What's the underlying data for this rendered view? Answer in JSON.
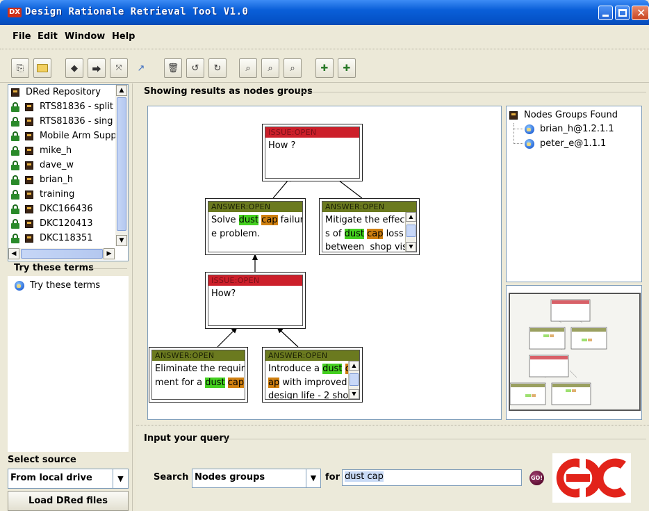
{
  "window": {
    "title": "Design Rationale Retrieval Tool V1.0",
    "icon_text": "DX"
  },
  "menu": [
    "File",
    "Edit",
    "Window",
    "Help"
  ],
  "toolbar": {
    "icons": [
      "copy-icon",
      "open-folder-icon",
      "add-node-icon",
      "add-link-icon",
      "expand-icon",
      "arrow-icon",
      "delete-icon",
      "undo-icon",
      "redo-icon",
      "zoom-icon",
      "zoom-in-icon",
      "zoom-out-icon",
      "add-issue-icon",
      "add-answer-icon"
    ]
  },
  "repository": {
    "root": "DRed Repository",
    "items": [
      "RTS81836 - split",
      "RTS81836 - sing",
      "Mobile Arm Supp",
      "mike_h",
      "dave_w",
      "brian_h",
      "training",
      "DKC166436",
      "DKC120413",
      "DKC118351"
    ]
  },
  "try_terms": {
    "title": "Try these terms",
    "items": [
      "Try these terms"
    ]
  },
  "source": {
    "label": "Select source",
    "value": "From local drive",
    "load_button": "Load DRed files"
  },
  "results": {
    "title": "Showing results as nodes groups",
    "nodes": [
      {
        "type": "ISSUE:OPEN",
        "lines": [
          [
            "How ?"
          ]
        ]
      },
      {
        "type": "ANSWER:OPEN",
        "lines": [
          [
            "Solve ",
            [
              "dust",
              "g"
            ],
            " ",
            [
              "cap",
              "o"
            ],
            " failur"
          ],
          [
            "e problem."
          ]
        ]
      },
      {
        "type": "ANSWER:OPEN",
        "lines": [
          [
            "Mitigate the effect"
          ],
          [
            "s of ",
            [
              "dust",
              "g"
            ],
            " ",
            [
              "cap",
              "o"
            ],
            " loss"
          ],
          [
            "between  shop vis"
          ]
        ]
      },
      {
        "type": "ISSUE:OPEN",
        "lines": [
          [
            "How?"
          ]
        ]
      },
      {
        "type": "ANSWER:OPEN",
        "lines": [
          [
            "Eliminate the require"
          ],
          [
            "ment for a ",
            [
              "dust",
              "g"
            ],
            " ",
            [
              "cap",
              "o"
            ]
          ]
        ]
      },
      {
        "type": "ANSWER:OPEN",
        "lines": [
          [
            "Introduce a ",
            [
              "dust",
              "g"
            ],
            " ",
            [
              "c",
              "o"
            ]
          ],
          [
            [
              "ap",
              "o"
            ],
            " with improved"
          ],
          [
            "design life - 2 sho"
          ]
        ]
      }
    ]
  },
  "groups": {
    "root": "Nodes Groups Found",
    "items": [
      "brian_h@1.2.1.1",
      "peter_e@1.1.1"
    ]
  },
  "query": {
    "title": "Input your query",
    "search_label": "Search",
    "type_value": "Nodes groups",
    "for_label": "for",
    "value": "dust cap",
    "go_label": "GO!"
  },
  "colors": {
    "issue_header": "#cc1f2a",
    "answer_header": "#6b7a1f",
    "highlight_green": "#44d020",
    "highlight_orange": "#d08010",
    "logo_red": "#e2231a"
  }
}
